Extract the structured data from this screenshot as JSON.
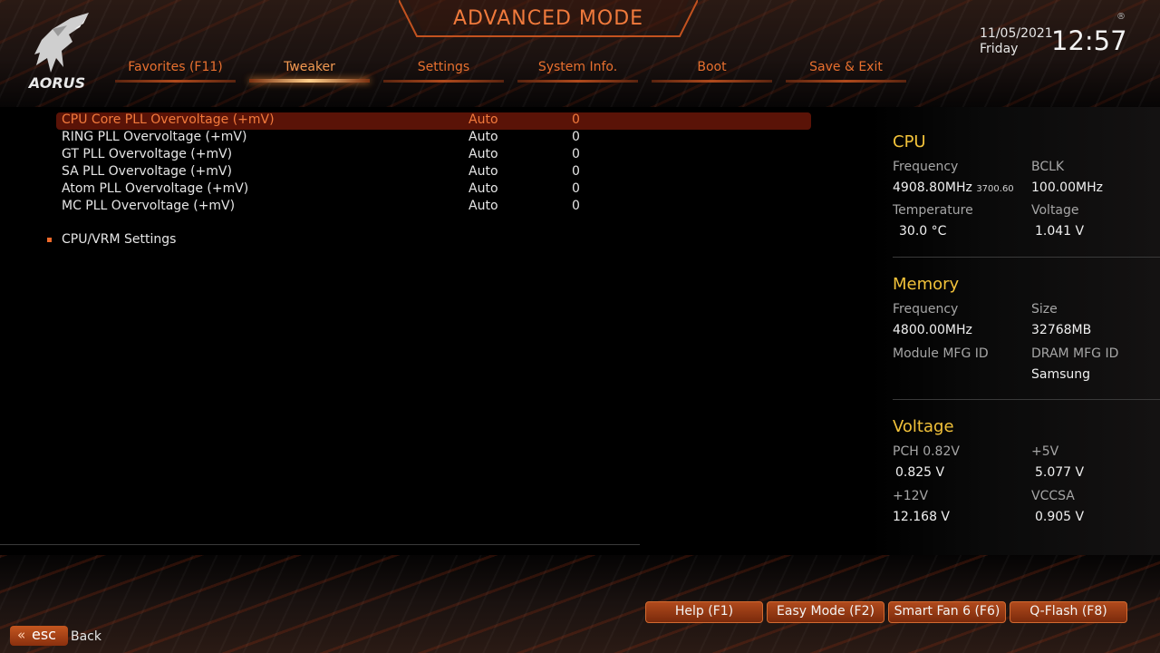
{
  "header": {
    "title": "ADVANCED MODE",
    "brand": "AORUS",
    "date": "11/05/2021",
    "day": "Friday",
    "time": "12:57",
    "registered_mark": "®"
  },
  "tabs": [
    {
      "label": "Favorites (F11)",
      "active": false
    },
    {
      "label": "Tweaker",
      "active": true
    },
    {
      "label": "Settings",
      "active": false
    },
    {
      "label": "System Info.",
      "active": false
    },
    {
      "label": "Boot",
      "active": false
    },
    {
      "label": "Save & Exit",
      "active": false
    }
  ],
  "settings": [
    {
      "label": "CPU Core PLL Overvoltage (+mV)",
      "option": "Auto",
      "value": "0",
      "selected": true
    },
    {
      "label": "RING PLL Overvoltage (+mV)",
      "option": "Auto",
      "value": "0",
      "selected": false
    },
    {
      "label": "GT PLL Overvoltage (+mV)",
      "option": "Auto",
      "value": "0",
      "selected": false
    },
    {
      "label": "SA PLL Overvoltage (+mV)",
      "option": "Auto",
      "value": "0",
      "selected": false
    },
    {
      "label": "Atom PLL Overvoltage (+mV)",
      "option": "Auto",
      "value": "0",
      "selected": false
    },
    {
      "label": "MC PLL Overvoltage (+mV)",
      "option": "Auto",
      "value": "0",
      "selected": false
    }
  ],
  "submenu": {
    "label": "CPU/VRM Settings"
  },
  "cpu": {
    "heading": "CPU",
    "frequency_label": "Frequency",
    "frequency_value": "4908.80MHz",
    "frequency_sub": "3700.60",
    "bclk_label": "BCLK",
    "bclk_value": "100.00MHz",
    "temperature_label": "Temperature",
    "temperature_value": "30.0 °C",
    "voltage_label": "Voltage",
    "voltage_value": "1.041 V"
  },
  "memory": {
    "heading": "Memory",
    "frequency_label": "Frequency",
    "frequency_value": "4800.00MHz",
    "size_label": "Size",
    "size_value": "32768MB",
    "module_mfg_label": "Module MFG ID",
    "dram_mfg_label": "DRAM MFG ID",
    "dram_mfg_value": "Samsung"
  },
  "voltage": {
    "heading": "Voltage",
    "pch_label": "PCH 0.82V",
    "pch_value": "0.825 V",
    "p5v_label": "+5V",
    "p5v_value": "5.077 V",
    "p12v_label": "+12V",
    "p12v_value": "12.168 V",
    "vccsa_label": "VCCSA",
    "vccsa_value": "0.905 V"
  },
  "function_buttons": [
    {
      "label": "Help (F1)"
    },
    {
      "label": "Easy Mode (F2)"
    },
    {
      "label": "Smart Fan 6 (F6)"
    },
    {
      "label": "Q-Flash (F8)"
    }
  ],
  "footer": {
    "esc_label": "esc",
    "back_label": "Back"
  },
  "colors": {
    "accent": "#f07a3c",
    "selected_row": "#5a1307",
    "panel_heading": "#f2c23a"
  }
}
